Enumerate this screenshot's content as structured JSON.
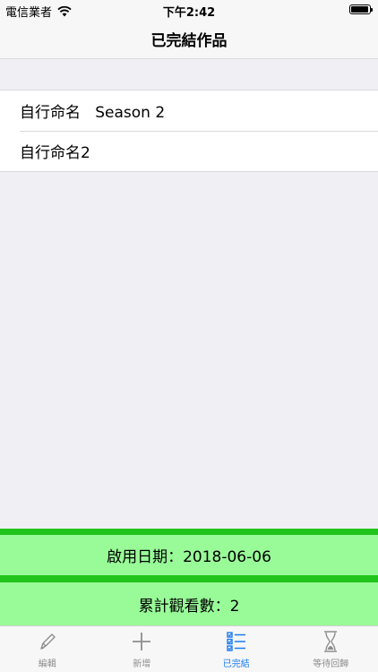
{
  "status_bar": {
    "carrier": "電信業者",
    "time": "下午2:42"
  },
  "nav": {
    "title": "已完結作品"
  },
  "list": {
    "items": [
      {
        "label": "自行命名   Season 2"
      },
      {
        "label": "自行命名2"
      }
    ]
  },
  "footer": {
    "start_date": "啟用日期：2018-06-06",
    "view_count": "累計觀看數：2"
  },
  "tab_bar": {
    "tabs": [
      {
        "label": "編輯",
        "icon": "pencil-icon",
        "active": false
      },
      {
        "label": "新增",
        "icon": "plus-icon",
        "active": false
      },
      {
        "label": "已完結",
        "icon": "checklist-icon",
        "active": true
      },
      {
        "label": "等待回歸",
        "icon": "hourglass-icon",
        "active": false
      }
    ],
    "active_color": "#1a7cf3",
    "inactive_color": "#8e8e8e"
  },
  "colors": {
    "banner_fill": "#98fb98",
    "banner_border": "#21c41a"
  }
}
